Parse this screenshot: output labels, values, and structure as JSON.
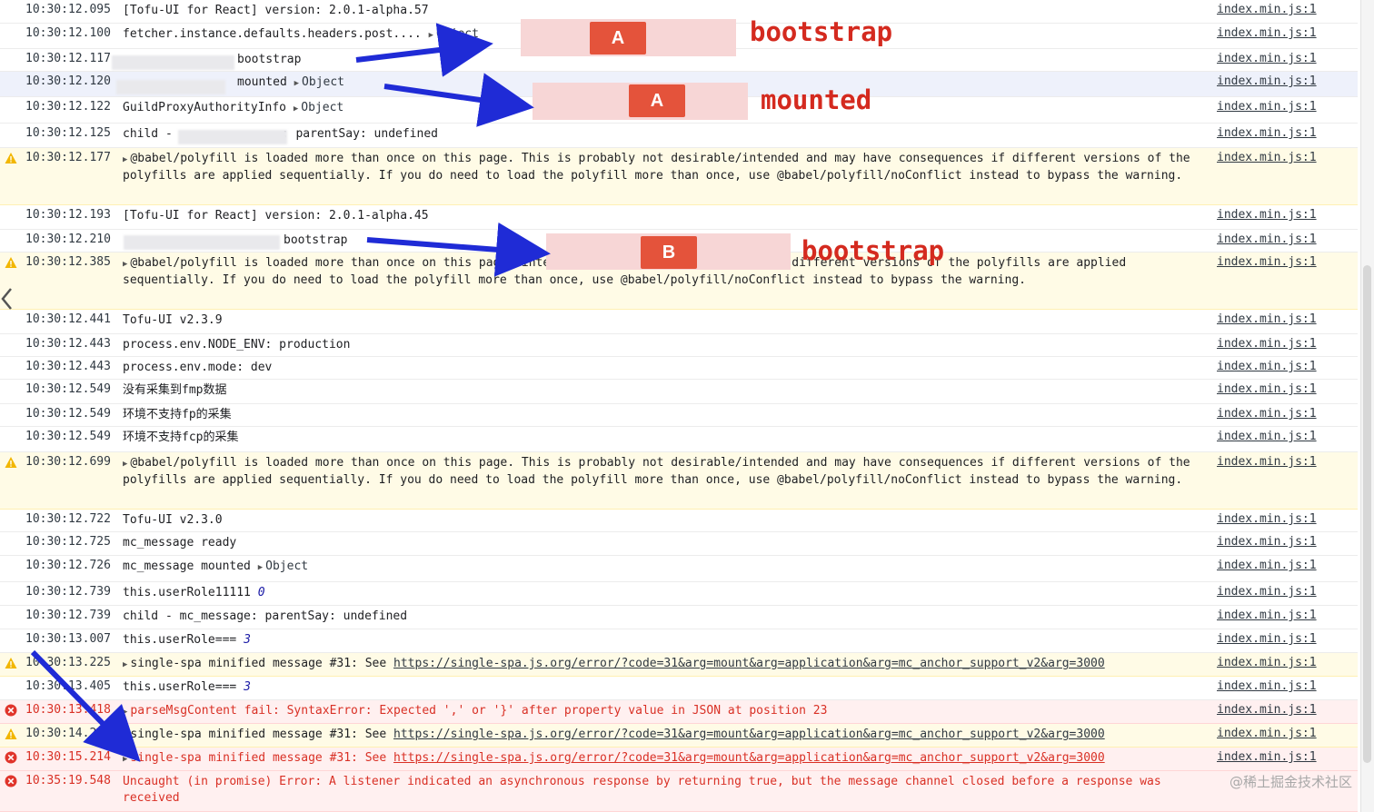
{
  "rows": [
    {
      "level": "info",
      "time": "10:30:12.095",
      "text": "[Tofu-UI for React] version: 2.0.1-alpha.57",
      "src": "index.min.js:1"
    },
    {
      "level": "info",
      "time": "10:30:12.100",
      "text": "fetcher.instance.defaults.headers.post....",
      "obj": "Object",
      "src": "index.min.js:1"
    },
    {
      "level": "info",
      "time": "10:30:12.117",
      "text": "bootstrap",
      "src": "index.min.js:1"
    },
    {
      "level": "info",
      "time": "10:30:12.120",
      "text": "mounted",
      "obj": "Object",
      "src": "index.min.js:1"
    },
    {
      "level": "info",
      "time": "10:30:12.122",
      "text": "GuildProxyAuthorityInfo",
      "obj": "Object",
      "src": "index.min.js:1"
    },
    {
      "level": "info",
      "time": "10:30:12.125",
      "text": "child -",
      "text2": ": parentSay: undefined",
      "src": "index.min.js:1"
    },
    {
      "level": "warn",
      "time": "10:30:12.177",
      "text": "@babel/polyfill is loaded more than once on this page. This is probably not desirable/intended and may have consequences if different versions of the polyfills are applied sequentially. If you do need to load the polyfill more than once, use @babel/polyfill/noConflict instead to bypass the warning.",
      "src": "index.min.js:1"
    },
    {
      "level": "info",
      "time": "10:30:12.193",
      "text": "[Tofu-UI for React] version: 2.0.1-alpha.45",
      "src": "index.min.js:1"
    },
    {
      "level": "info",
      "time": "10:30:12.210",
      "text": "bootstrap",
      "src": "index.min.js:1"
    },
    {
      "level": "warn",
      "time": "10:30:12.385",
      "text": "@babel/polyfill is loaded more than once on this page.",
      "text2": "intended and may have consequences if different versions of the polyfills are applied sequentially. If you do need to load the polyfill more than once, use @babel/polyfill/noConflict instead to bypass the warning.",
      "src": "index.min.js:1"
    },
    {
      "level": "info",
      "time": "10:30:12.441",
      "text": "Tofu-UI v2.3.9",
      "src": "index.min.js:1"
    },
    {
      "level": "info",
      "time": "10:30:12.443",
      "text": "process.env.NODE_ENV: production",
      "src": "index.min.js:1"
    },
    {
      "level": "info",
      "time": "10:30:12.443",
      "text": "process.env.mode: dev",
      "src": "index.min.js:1"
    },
    {
      "level": "info",
      "time": "10:30:12.549",
      "text": "没有采集到fmp数据",
      "src": "index.min.js:1"
    },
    {
      "level": "info",
      "time": "10:30:12.549",
      "text": "环境不支持fp的采集",
      "src": "index.min.js:1"
    },
    {
      "level": "info",
      "time": "10:30:12.549",
      "text": "环境不支持fcp的采集",
      "src": "index.min.js:1"
    },
    {
      "level": "warn",
      "time": "10:30:12.699",
      "text": "@babel/polyfill is loaded more than once on this page. This is probably not desirable/intended and may have consequences if different versions of the polyfills are applied sequentially. If you do need to load the polyfill more than once, use @babel/polyfill/noConflict instead to bypass the warning.",
      "src": "index.min.js:1"
    },
    {
      "level": "info",
      "time": "10:30:12.722",
      "text": "Tofu-UI v2.3.0",
      "src": "index.min.js:1"
    },
    {
      "level": "info",
      "time": "10:30:12.725",
      "text": "mc_message ready",
      "src": "index.min.js:1"
    },
    {
      "level": "info",
      "time": "10:30:12.726",
      "text": "mc_message mounted",
      "obj": "Object",
      "src": "index.min.js:1"
    },
    {
      "level": "info",
      "time": "10:30:12.739",
      "text": "this.userRole11111",
      "num": "0",
      "src": "index.min.js:1"
    },
    {
      "level": "info",
      "time": "10:30:12.739",
      "text": "child - mc_message: parentSay: undefined",
      "src": "index.min.js:1"
    },
    {
      "level": "info",
      "time": "10:30:13.007",
      "text": "this.userRole===",
      "num": "3",
      "src": "index.min.js:1"
    },
    {
      "level": "warn",
      "time": "10:30:13.225",
      "text": "single-spa minified message #31: See",
      "link": "https://single-spa.js.org/error/?code=31&arg=mount&arg=application&arg=mc_anchor_support_v2&arg=3000",
      "src": "index.min.js:1"
    },
    {
      "level": "info",
      "time": "10:30:13.405",
      "text": "this.userRole===",
      "num": "3",
      "src": "index.min.js:1"
    },
    {
      "level": "error",
      "time": "10:30:13.418",
      "text": "parseMsgContent fail: SyntaxError: Expected ',' or '}' after property value in JSON at position 23",
      "src": "index.min.js:1"
    },
    {
      "level": "warn",
      "time": "10:30:14.23",
      "text": "single-spa minified message #31: See",
      "link": "https://single-spa.js.org/error/?code=31&arg=mount&arg=application&arg=mc_anchor_support_v2&arg=3000",
      "src": "index.min.js:1"
    },
    {
      "level": "error",
      "time": "10:30:15.214",
      "text": "single-spa minified message #31: See",
      "link": "https://single-spa.js.org/error/?code=31&arg=mount&arg=application&arg=mc_anchor_support_v2&arg=3000",
      "src": "index.min.js:1"
    },
    {
      "level": "error",
      "time": "10:35:19.548",
      "text": "Uncaught (in promise) Error: A listener indicated an asynchronous response by returning true, but the message channel closed before a response was received",
      "src": ""
    }
  ],
  "annotations": {
    "badge_a1": "A",
    "label_a1": "bootstrap",
    "badge_a2": "A",
    "label_a2": "mounted",
    "badge_b": "B",
    "label_b": "bootstrap"
  },
  "watermark": "@稀土掘金技术社区",
  "colors": {
    "warn_bg": "#fffbe6",
    "error_bg": "#fff0f0",
    "error_text": "#d93025",
    "annotation_red": "#d42a1f",
    "arrow_blue": "#1f2bd6",
    "badge": "#e4533b"
  }
}
